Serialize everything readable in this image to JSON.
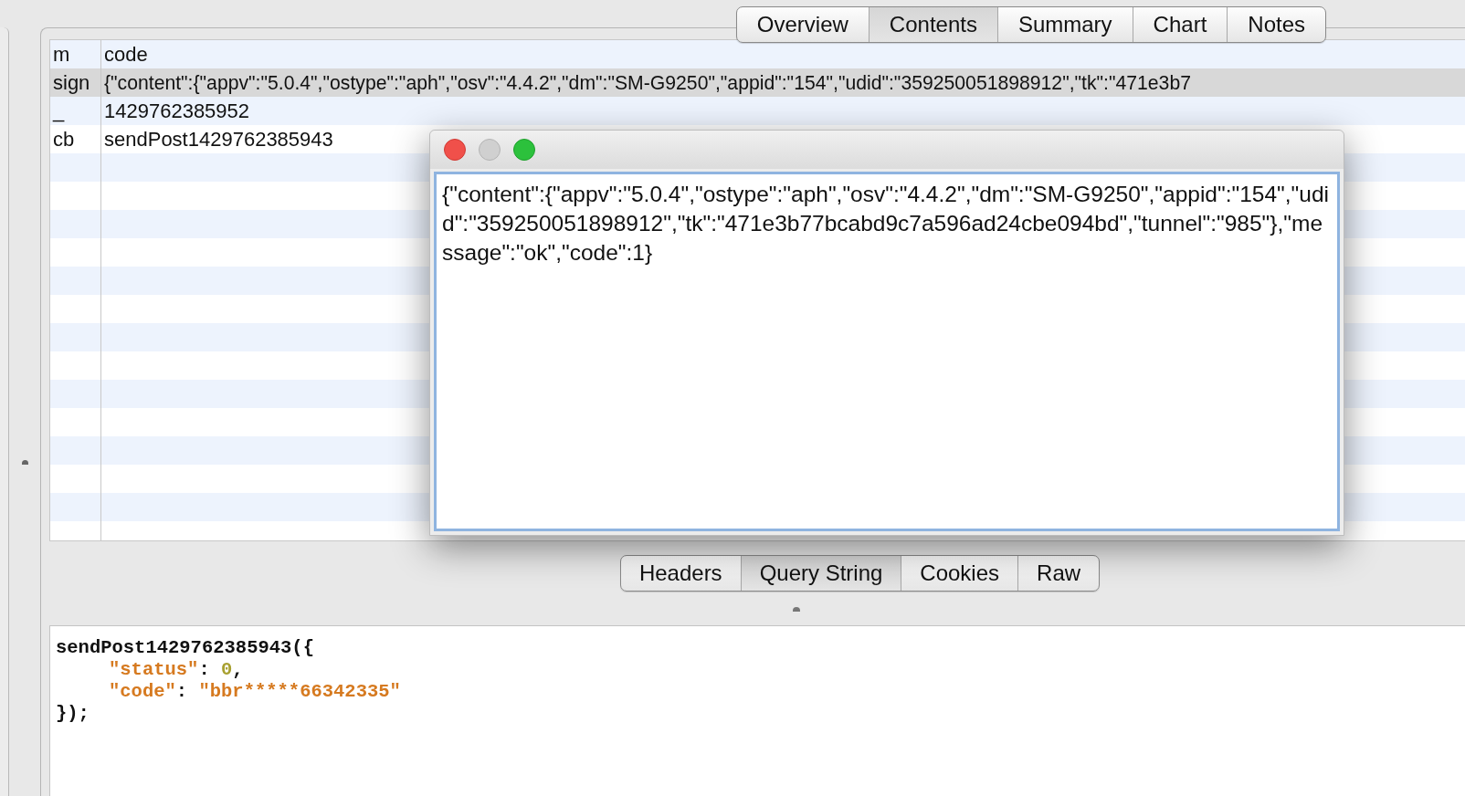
{
  "top_tabs": [
    {
      "label": "Overview",
      "selected": false
    },
    {
      "label": "Contents",
      "selected": true
    },
    {
      "label": "Summary",
      "selected": false
    },
    {
      "label": "Chart",
      "selected": false
    },
    {
      "label": "Notes",
      "selected": false
    }
  ],
  "table": {
    "columns": [
      "m",
      "code"
    ],
    "rows": [
      {
        "cells": [
          "sign",
          "{\"content\":{\"appv\":\"5.0.4\",\"ostype\":\"aph\",\"osv\":\"4.4.2\",\"dm\":\"SM-G9250\",\"appid\":\"154\",\"udid\":\"359250051898912\",\"tk\":\"471e3b7"
        ],
        "selected": true
      },
      {
        "cells": [
          "_",
          "1429762385952"
        ],
        "selected": false
      },
      {
        "cells": [
          "cb",
          "sendPost1429762385943"
        ],
        "selected": false
      }
    ]
  },
  "dialog": {
    "text": "{\"content\":{\"appv\":\"5.0.4\",\"ostype\":\"aph\",\"osv\":\"4.4.2\",\"dm\":\"SM-G9250\",\"appid\":\"154\",\"udid\":\"359250051898912\",\"tk\":\"471e3b77bcabd9c7a596ad24cbe094bd\",\"tunnel\":\"985\"},\"message\":\"ok\",\"code\":1}"
  },
  "bottom_tabs": [
    {
      "label": "Headers",
      "selected": false
    },
    {
      "label": "Query String",
      "selected": true
    },
    {
      "label": "Cookies",
      "selected": false
    },
    {
      "label": "Raw",
      "selected": false
    }
  ],
  "code_view": {
    "lines": [
      {
        "kind": "outer",
        "segments": [
          {
            "kind": "plain",
            "text": "sendPost1429762385943({"
          }
        ]
      },
      {
        "kind": "inner",
        "segments": [
          {
            "kind": "key",
            "text": "\"status\""
          },
          {
            "kind": "plain",
            "text": ": "
          },
          {
            "kind": "number",
            "text": "0"
          },
          {
            "kind": "plain",
            "text": ","
          }
        ]
      },
      {
        "kind": "inner",
        "segments": [
          {
            "kind": "key",
            "text": "\"code\""
          },
          {
            "kind": "plain",
            "text": ": "
          },
          {
            "kind": "string",
            "text": "\"bbr*****66342335\""
          }
        ]
      },
      {
        "kind": "outer",
        "segments": [
          {
            "kind": "plain",
            "text": "});"
          }
        ]
      }
    ]
  }
}
